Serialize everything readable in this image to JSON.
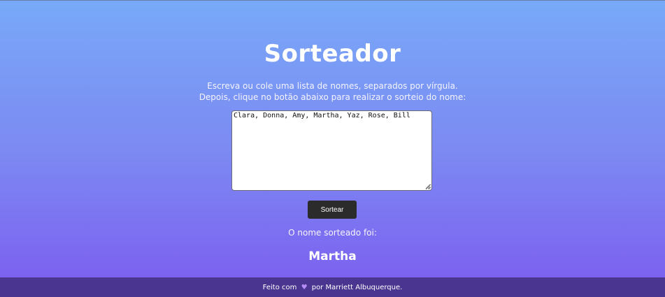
{
  "app": {
    "title": "Sorteador",
    "instructions": [
      "Escreva ou cole uma lista de nomes, separados por vírgula.",
      "Depois, clique no botão abaixo para realizar o sorteio do nome:"
    ]
  },
  "names_input": {
    "value": "Clara, Donna, Amy, Martha, Yaz, Rose, Bill"
  },
  "draw_button": {
    "label": "Sortear"
  },
  "result": {
    "label": "O nome sorteado foi:",
    "name": "Martha"
  },
  "footer": {
    "prefix": "Feito com",
    "heart_icon": "heart-icon",
    "suffix": "por Marriett Albuquerque."
  },
  "colors": {
    "gradient_top": "#78a9f8",
    "gradient_bottom": "#7c5cf0",
    "button_bg": "#2b2b2b",
    "footer_bg": "#4a3590",
    "heart": "#b58cf5"
  }
}
